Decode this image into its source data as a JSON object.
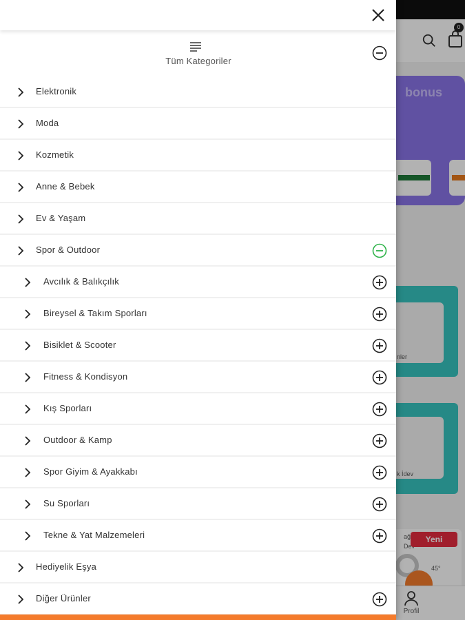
{
  "drawer": {
    "header_title": "Tüm Kategoriler",
    "accent_color": "#f47b2c",
    "expanded_color": "#2fb34a",
    "categories": [
      {
        "label": "Elektronik",
        "level": 0,
        "toggle": "none"
      },
      {
        "label": "Moda",
        "level": 0,
        "toggle": "none"
      },
      {
        "label": "Kozmetik",
        "level": 0,
        "toggle": "none"
      },
      {
        "label": "Anne & Bebek",
        "level": 0,
        "toggle": "none"
      },
      {
        "label": "Ev & Yaşam",
        "level": 0,
        "toggle": "none"
      },
      {
        "label": "Spor & Outdoor",
        "level": 0,
        "toggle": "minus-green"
      },
      {
        "label": "Avcılık & Balıkçılık",
        "level": 1,
        "toggle": "plus"
      },
      {
        "label": "Bireysel & Takım Sporları",
        "level": 1,
        "toggle": "plus"
      },
      {
        "label": "Bisiklet & Scooter",
        "level": 1,
        "toggle": "plus"
      },
      {
        "label": "Fitness & Kondisyon",
        "level": 1,
        "toggle": "plus"
      },
      {
        "label": "Kış Sporları",
        "level": 1,
        "toggle": "plus"
      },
      {
        "label": "Outdoor & Kamp",
        "level": 1,
        "toggle": "plus"
      },
      {
        "label": "Spor Giyim & Ayakkabı",
        "level": 1,
        "toggle": "plus"
      },
      {
        "label": "Su Sporları",
        "level": 1,
        "toggle": "plus"
      },
      {
        "label": "Tekne & Yat Malzemeleri",
        "level": 1,
        "toggle": "plus"
      },
      {
        "label": "Hediyelik Eşya",
        "level": 0,
        "toggle": "none"
      },
      {
        "label": "Diğer Ürünler",
        "level": 0,
        "toggle": "plus"
      }
    ]
  },
  "background": {
    "cart_count": "0",
    "banner_text": "bonus",
    "new_badge": "Yeni",
    "profile_label": "Profil",
    "card1_text": "nler",
    "card2_text": "k İdev",
    "product_text_1": "ağışı",
    "product_text_2": "Dev",
    "product_temp": "45°"
  }
}
